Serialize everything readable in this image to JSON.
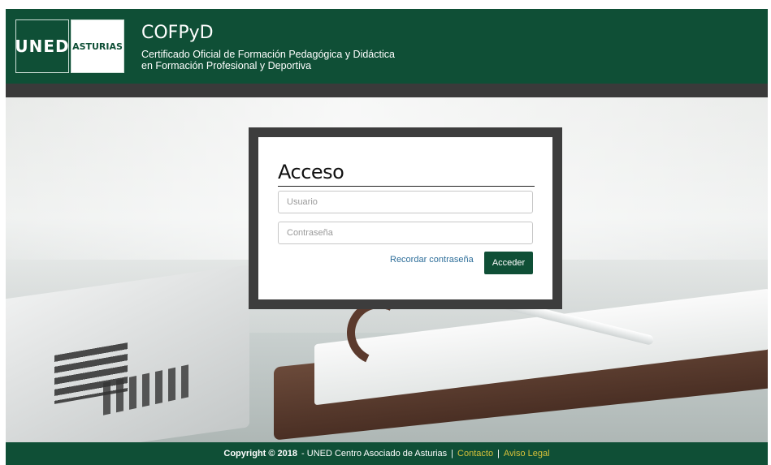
{
  "header": {
    "logo_uned": "UNED",
    "logo_asturias": "ASTURIAS",
    "title": "COFPyD",
    "subtitle_line1": "Certificado Oficial de Formación Pedagógica y Didáctica",
    "subtitle_line2": "en Formación Profesional y Deportiva"
  },
  "login": {
    "title": "Acceso",
    "username_placeholder": "Usuario",
    "password_placeholder": "Contraseña",
    "forgot_link": "Recordar contraseña",
    "submit_label": "Acceder"
  },
  "footer": {
    "copyright": "Copyright © 2018",
    "org": "- UNED Centro Asociado de Asturias",
    "separator": "|",
    "contact_link": "Contacto",
    "legal_link": "Aviso Legal"
  },
  "colors": {
    "brand_green": "#0f4f36",
    "dark_bar": "#3a3a3a",
    "link_blue": "#2f6f9a",
    "footer_link": "#d8c23a"
  }
}
